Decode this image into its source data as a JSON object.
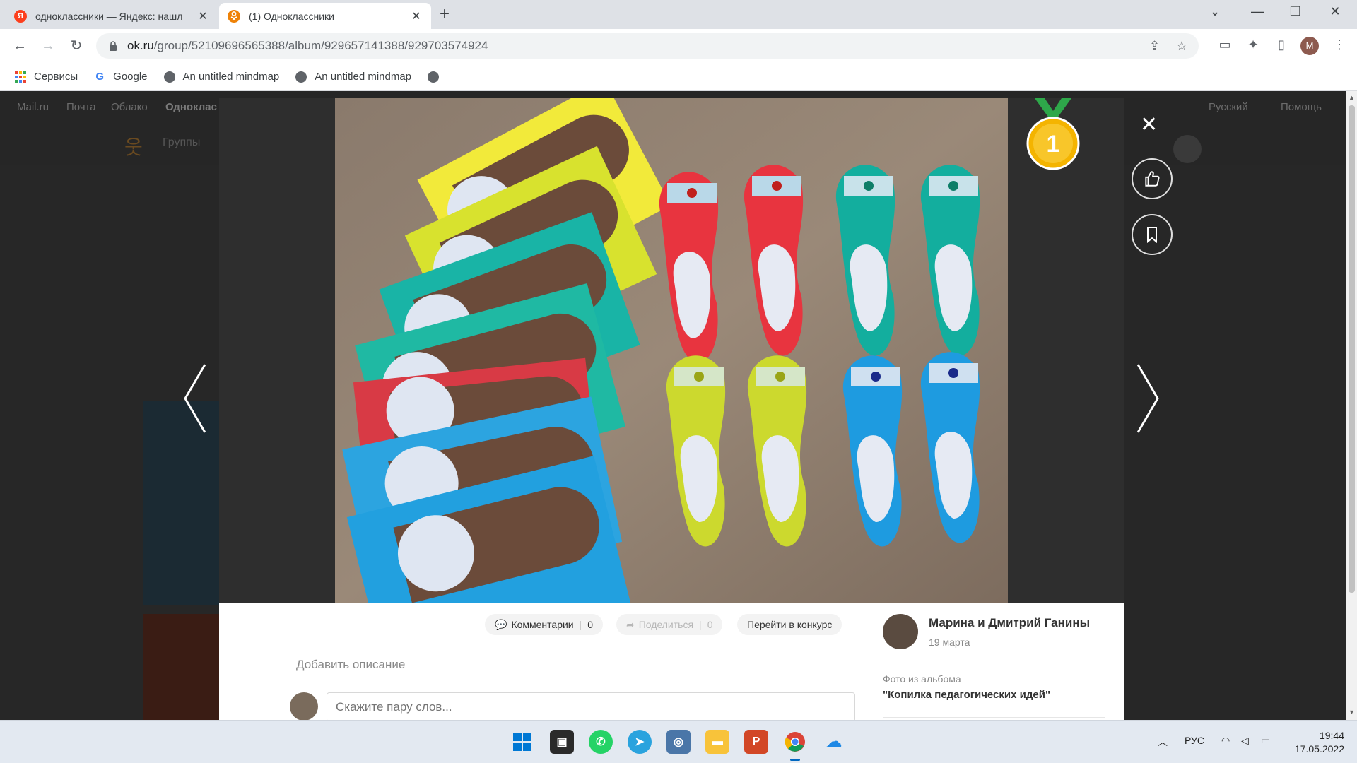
{
  "browser": {
    "tabs": [
      {
        "title": "одноклассники — Яндекс: нашл",
        "favicon": "yandex-icon",
        "active": false
      },
      {
        "title": "(1) Одноклассники",
        "favicon": "ok-icon",
        "active": true
      }
    ],
    "url_host": "ok.ru",
    "url_path": "/group/52109696565388/album/929657141388/929703574924",
    "profile_initial": "M",
    "bookmarks": [
      {
        "label": "Сервисы",
        "icon": "apps-icon"
      },
      {
        "label": "Google",
        "icon": "google-icon"
      },
      {
        "label": "An untitled mindmap",
        "icon": "globe-icon"
      },
      {
        "label": "An untitled mindmap",
        "icon": "globe-icon"
      },
      {
        "label": "",
        "icon": "globe-icon"
      }
    ]
  },
  "page_bg": {
    "topnav": [
      "Mail.ru",
      "Почта",
      "Облако",
      "Одноклас"
    ],
    "lang": "Русский",
    "help": "Помощь",
    "groups": "Группы"
  },
  "viewer": {
    "medal_number": "1",
    "actions": {
      "comments_label": "Комментарии",
      "comments_count": "0",
      "share_label": "Поделиться",
      "share_count": "0",
      "contest_label": "Перейти в конкурс"
    },
    "add_description": "Добавить описание",
    "comment_placeholder": "Скажите пару слов...",
    "author": {
      "name": "Марина и Дмитрий Ганины",
      "date": "19 марта"
    },
    "album_label": "Фото из альбома",
    "album_name": "\"Копилка педагогических идей\""
  },
  "taskbar": {
    "language": "РУС",
    "time": "19:44",
    "date": "17.05.2022"
  },
  "colors": {
    "ok_orange": "#ee8208",
    "accent_blue": "#0067c0"
  }
}
